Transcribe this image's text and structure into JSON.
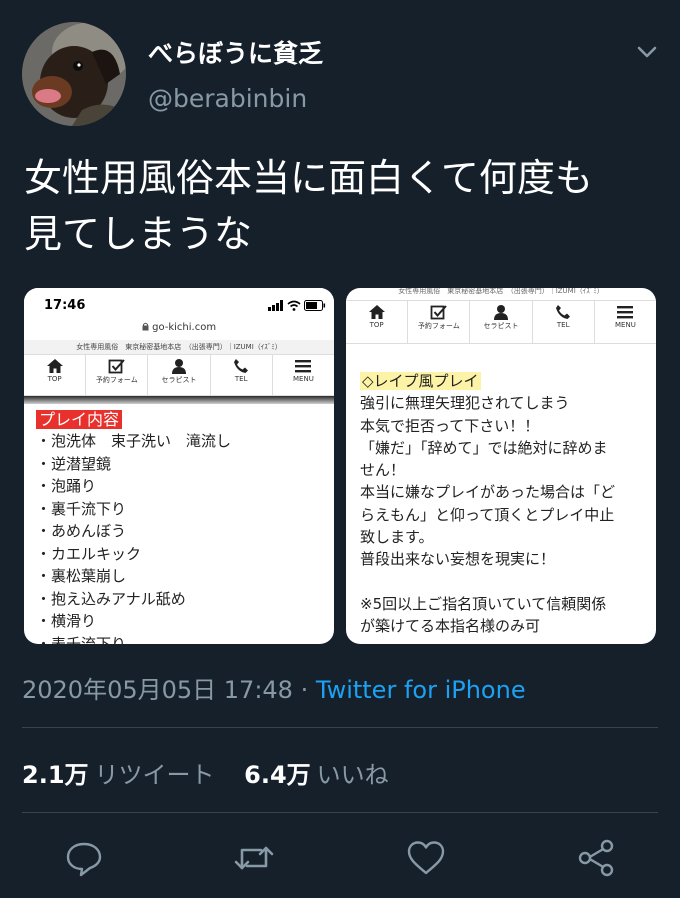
{
  "user": {
    "display_name": "べらぼうに貧乏",
    "handle": "@berabinbin"
  },
  "tweet": {
    "text_line1": "女性用風俗本当に面白くて何度も",
    "text_line2": "見てしまうな",
    "timestamp": "2020年05月05日 17:48",
    "separator": "·",
    "via": "Twitter for iPhone"
  },
  "stats": {
    "retweets_count": "2.1万",
    "retweets_label": "リツイート",
    "likes_count": "6.4万",
    "likes_label": "いいね"
  },
  "media_left": {
    "time": "17:46",
    "url": "go-kichi.com",
    "site_header": "女性専用風俗　東京秘密基地本店　（出張専門）｜IZUMI（ｲｽﾞﾐ）",
    "nav": [
      "TOP",
      "予約フォーム",
      "セラピスト",
      "TEL",
      "MENU"
    ],
    "section_title": "プレイ内容",
    "items": [
      "・泡洗体　束子洗い　滝流し",
      "・逆潜望鏡",
      "・泡踊り",
      "・裏千流下り",
      "・あめんぼう",
      "・カエルキック",
      "・裏松葉崩し",
      "・抱え込みアナル舐め",
      "・横滑り",
      "・表千流下り"
    ]
  },
  "media_right": {
    "site_header": "女性専用風俗　東京秘密基地本店　（出張専門）｜IZUMI（ｲｽﾞﾐ）",
    "nav": [
      "TOP",
      "予約フォーム",
      "セラピスト",
      "TEL",
      "MENU"
    ],
    "section_title": "◇レイプ風プレイ",
    "lines": [
      "強引に無理矢理犯されてしまう",
      "本気で拒否って下さい！！",
      "「嫌だ」「辞めて」では絶対に辞めま",
      "せん！",
      "本当に嫌なプレイがあった場合は「ど",
      "らえもん」と仰って頂くとプレイ中止",
      "致します。",
      "普段出来ない妄想を現実に！",
      "",
      "※5回以上ご指名頂いていて信頼関係",
      "が築けてる本指名様のみ可"
    ]
  },
  "colors": {
    "background": "#15202b",
    "secondary_text": "#8899a6",
    "link": "#1da1f2",
    "divider": "#38444d",
    "highlight_red": "#e8302c",
    "highlight_yellow": "#fcf3a6"
  },
  "icons": [
    "caret-down-icon",
    "reply-icon",
    "retweet-icon",
    "like-icon",
    "share-icon",
    "home-icon",
    "reserve-icon",
    "therapist-icon",
    "phone-icon",
    "menu-icon",
    "signal-icon",
    "wifi-icon",
    "battery-icon",
    "lock-icon"
  ]
}
